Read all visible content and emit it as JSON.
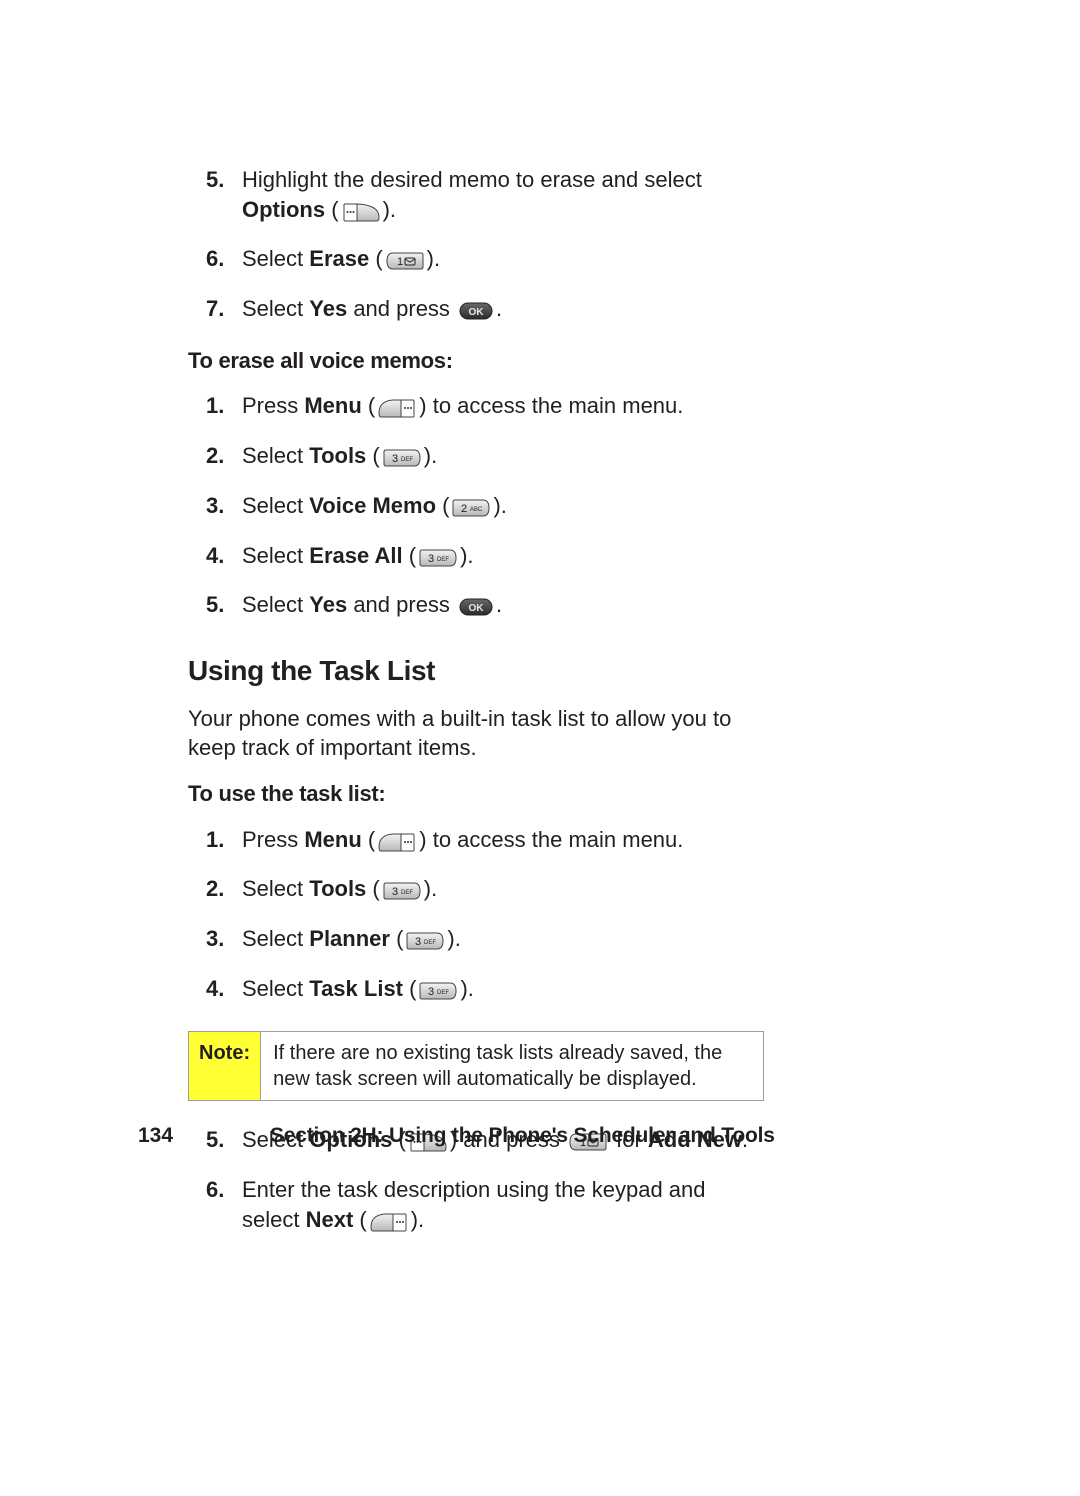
{
  "lists": {
    "topSteps": [
      {
        "n": "5.",
        "pre": "Highlight the desired memo to erase and select ",
        "bold": "Options",
        "post1": " (",
        "icon": "soft-right",
        "post2": ")."
      },
      {
        "n": "6.",
        "pre": "Select ",
        "bold": "Erase",
        "post1": " (",
        "icon": "key1-left",
        "post2": ")."
      },
      {
        "n": "7.",
        "pre": "Select ",
        "bold": "Yes",
        "post1": " and press ",
        "icon": "ok",
        "post2": "."
      }
    ],
    "eraseAllSteps": [
      {
        "n": "1.",
        "pre": "Press ",
        "bold": "Menu",
        "post1": " (",
        "icon": "soft-left",
        "post2": ") to access the main menu."
      },
      {
        "n": "2.",
        "pre": "Select ",
        "bold": "Tools",
        "post1": " (",
        "icon": "key3-right",
        "post2": ")."
      },
      {
        "n": "3.",
        "pre": "Select ",
        "bold": "Voice Memo",
        "post1": " (",
        "icon": "key2-right",
        "post2": ")."
      },
      {
        "n": "4.",
        "pre": "Select ",
        "bold": "Erase All",
        "post1": " (",
        "icon": "key3-right",
        "post2": ")."
      },
      {
        "n": "5.",
        "pre": "Select ",
        "bold": "Yes",
        "post1": " and press ",
        "icon": "ok",
        "post2": "."
      }
    ],
    "taskSteps1": [
      {
        "n": "1.",
        "pre": "Press ",
        "bold": "Menu",
        "post1": " (",
        "icon": "soft-left",
        "post2": ") to access the main menu."
      },
      {
        "n": "2.",
        "pre": "Select ",
        "bold": "Tools",
        "post1": " (",
        "icon": "key3-right",
        "post2": ")."
      },
      {
        "n": "3.",
        "pre": "Select ",
        "bold": "Planner",
        "post1": " (",
        "icon": "key3-right",
        "post2": ")."
      },
      {
        "n": "4.",
        "pre": "Select ",
        "bold": "Task List",
        "post1": " (",
        "icon": "key3-right",
        "post2": ")."
      }
    ],
    "taskSteps2": [
      {
        "n": "5.",
        "parts": [
          {
            "t": "Select "
          },
          {
            "b": "Options"
          },
          {
            "t": " ("
          },
          {
            "icon": "soft-right"
          },
          {
            "t": ") and press "
          },
          {
            "icon": "key1-left"
          },
          {
            "t": " for "
          },
          {
            "b": "Add New"
          },
          {
            "t": "."
          }
        ]
      },
      {
        "n": "6.",
        "parts": [
          {
            "t": "Enter the task description using the keypad and select "
          },
          {
            "b": "Next"
          },
          {
            "t": " ("
          },
          {
            "icon": "soft-left"
          },
          {
            "t": ")."
          }
        ]
      }
    ]
  },
  "subheads": {
    "eraseAll": "To erase all voice memos:",
    "useTask": "To use the task list:"
  },
  "sectionTitle": "Using the Task List",
  "introPara": "Your phone comes with a built-in task list to allow you to keep track of important items.",
  "note": {
    "label": "Note:",
    "body": "If there are no existing task lists already saved, the new task screen will automatically be displayed."
  },
  "footer": {
    "page": "134",
    "section": "Section 2H: Using the Phone's Scheduler and Tools"
  }
}
